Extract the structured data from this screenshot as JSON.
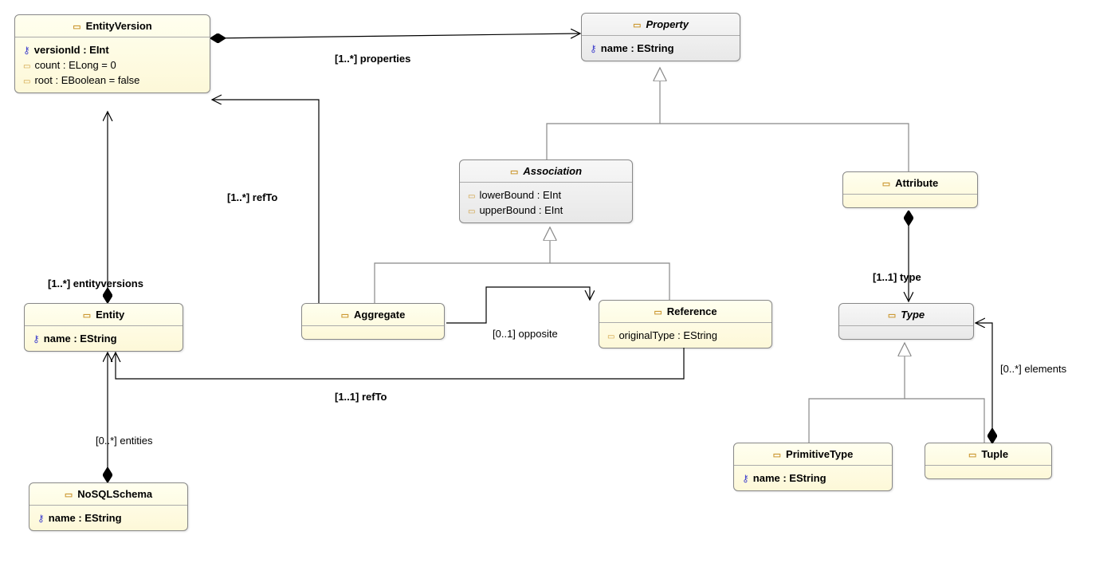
{
  "classes": {
    "EntityVersion": {
      "name": "EntityVersion",
      "attrs": {
        "versionId": "versionId : EInt",
        "count": "count : ELong = 0",
        "root": "root : EBoolean = false"
      }
    },
    "Property": {
      "name": "Property",
      "attrs": {
        "name": "name : EString"
      }
    },
    "Association": {
      "name": "Association",
      "attrs": {
        "lowerBound": "lowerBound : EInt",
        "upperBound": "upperBound : EInt"
      }
    },
    "Attribute": {
      "name": "Attribute"
    },
    "Entity": {
      "name": "Entity",
      "attrs": {
        "name": "name : EString"
      }
    },
    "Aggregate": {
      "name": "Aggregate"
    },
    "Reference": {
      "name": "Reference",
      "attrs": {
        "originalType": "originalType : EString"
      }
    },
    "Type": {
      "name": "Type"
    },
    "NoSQLSchema": {
      "name": "NoSQLSchema",
      "attrs": {
        "name": "name : EString"
      }
    },
    "PrimitiveType": {
      "name": "PrimitiveType",
      "attrs": {
        "name": "name : EString"
      }
    },
    "Tuple": {
      "name": "Tuple"
    }
  },
  "relations": {
    "properties": "[1..*] properties",
    "refToAgg": "[1..*] refTo",
    "entityversions": "[1..*] entityversions",
    "opposite": "[0..1] opposite",
    "refToRef": "[1..1] refTo",
    "entities": "[0..*] entities",
    "type": "[1..1] type",
    "elements": "[0..*] elements"
  }
}
